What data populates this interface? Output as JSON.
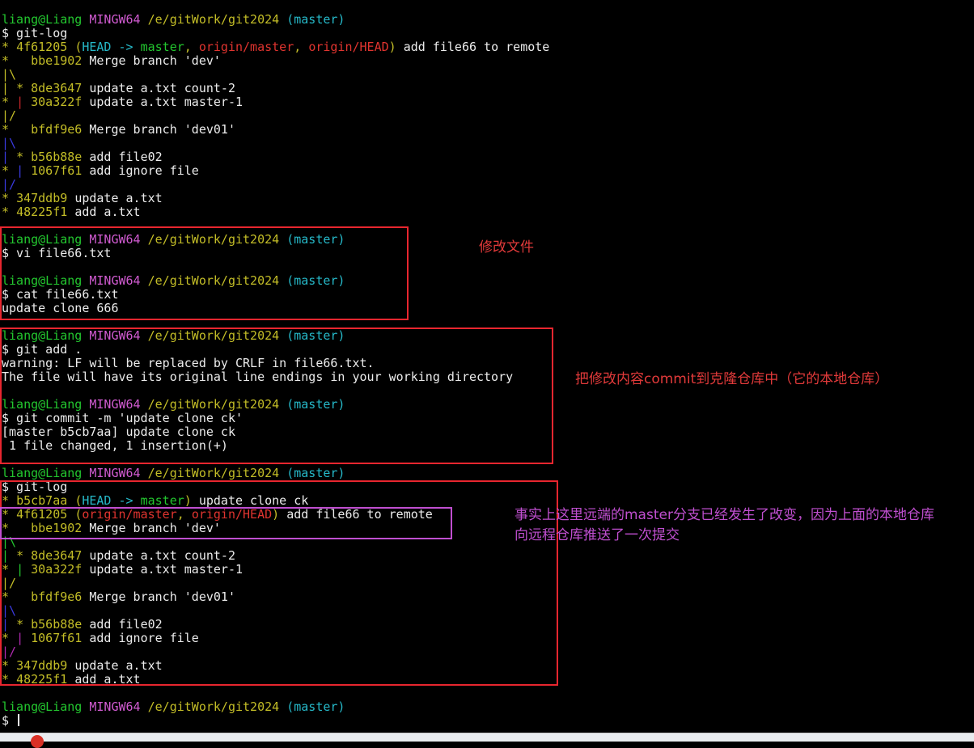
{
  "terminal": {
    "lines": [
      [
        {
          "t": "liang@Liang ",
          "c": "green"
        },
        {
          "t": "MINGW64 ",
          "c": "magenta"
        },
        {
          "t": "/e/gitWork/git2024 ",
          "c": "yellow"
        },
        {
          "t": "(master)",
          "c": "cyan"
        }
      ],
      [
        {
          "t": "$ git-log",
          "c": "white"
        }
      ],
      [
        {
          "t": "* ",
          "c": "gy"
        },
        {
          "t": "4f61205 ",
          "c": "yellow"
        },
        {
          "t": "(",
          "c": "yellow"
        },
        {
          "t": "HEAD -> ",
          "c": "cyan"
        },
        {
          "t": "master",
          "c": "green"
        },
        {
          "t": ", ",
          "c": "yellow"
        },
        {
          "t": "origin/master",
          "c": "red"
        },
        {
          "t": ", ",
          "c": "yellow"
        },
        {
          "t": "origin/HEAD",
          "c": "red"
        },
        {
          "t": ")",
          "c": "yellow"
        },
        {
          "t": " add file66 to remote",
          "c": "white"
        }
      ],
      [
        {
          "t": "*   ",
          "c": "gy"
        },
        {
          "t": "bbe1902 ",
          "c": "yellow"
        },
        {
          "t": "Merge branch 'dev'",
          "c": "white"
        }
      ],
      [
        {
          "t": "|\\",
          "c": "gy"
        }
      ],
      [
        {
          "t": "| ",
          "c": "gy"
        },
        {
          "t": "* ",
          "c": "gy"
        },
        {
          "t": "8de3647 ",
          "c": "yellow"
        },
        {
          "t": "update a.txt count-2",
          "c": "white"
        }
      ],
      [
        {
          "t": "* ",
          "c": "gy"
        },
        {
          "t": "| ",
          "c": "gr"
        },
        {
          "t": "30a322f ",
          "c": "yellow"
        },
        {
          "t": "update a.txt master-1",
          "c": "white"
        }
      ],
      [
        {
          "t": "|/",
          "c": "gy"
        }
      ],
      [
        {
          "t": "*   ",
          "c": "gy"
        },
        {
          "t": "bfdf9e6 ",
          "c": "yellow"
        },
        {
          "t": "Merge branch 'dev01'",
          "c": "white"
        }
      ],
      [
        {
          "t": "|\\",
          "c": "gb"
        }
      ],
      [
        {
          "t": "| ",
          "c": "gb"
        },
        {
          "t": "* ",
          "c": "gy"
        },
        {
          "t": "b56b88e ",
          "c": "yellow"
        },
        {
          "t": "add file02",
          "c": "white"
        }
      ],
      [
        {
          "t": "* ",
          "c": "gy"
        },
        {
          "t": "| ",
          "c": "gb"
        },
        {
          "t": "1067f61 ",
          "c": "yellow"
        },
        {
          "t": "add ignore file",
          "c": "white"
        }
      ],
      [
        {
          "t": "|/",
          "c": "gb"
        }
      ],
      [
        {
          "t": "* ",
          "c": "gy"
        },
        {
          "t": "347ddb9 ",
          "c": "yellow"
        },
        {
          "t": "update a.txt",
          "c": "white"
        }
      ],
      [
        {
          "t": "* ",
          "c": "gy"
        },
        {
          "t": "48225f1 ",
          "c": "yellow"
        },
        {
          "t": "add a.txt",
          "c": "white"
        }
      ],
      [
        {
          "t": "",
          "c": "white"
        }
      ],
      [
        {
          "t": "liang@Liang ",
          "c": "green"
        },
        {
          "t": "MINGW64 ",
          "c": "magenta"
        },
        {
          "t": "/e/gitWork/git2024 ",
          "c": "yellow"
        },
        {
          "t": "(master)",
          "c": "cyan"
        }
      ],
      [
        {
          "t": "$ vi file66.txt",
          "c": "white"
        }
      ],
      [
        {
          "t": "",
          "c": "white"
        }
      ],
      [
        {
          "t": "liang@Liang ",
          "c": "green"
        },
        {
          "t": "MINGW64 ",
          "c": "magenta"
        },
        {
          "t": "/e/gitWork/git2024 ",
          "c": "yellow"
        },
        {
          "t": "(master)",
          "c": "cyan"
        }
      ],
      [
        {
          "t": "$ cat file66.txt",
          "c": "white"
        }
      ],
      [
        {
          "t": "update clone 666",
          "c": "white"
        }
      ],
      [
        {
          "t": "",
          "c": "white"
        }
      ],
      [
        {
          "t": "liang@Liang ",
          "c": "green"
        },
        {
          "t": "MINGW64 ",
          "c": "magenta"
        },
        {
          "t": "/e/gitWork/git2024 ",
          "c": "yellow"
        },
        {
          "t": "(master)",
          "c": "cyan"
        }
      ],
      [
        {
          "t": "$ git add .",
          "c": "white"
        }
      ],
      [
        {
          "t": "warning: LF will be replaced by CRLF in file66.txt.",
          "c": "white"
        }
      ],
      [
        {
          "t": "The file will have its original line endings in your working directory",
          "c": "white"
        }
      ],
      [
        {
          "t": "",
          "c": "white"
        }
      ],
      [
        {
          "t": "liang@Liang ",
          "c": "green"
        },
        {
          "t": "MINGW64 ",
          "c": "magenta"
        },
        {
          "t": "/e/gitWork/git2024 ",
          "c": "yellow"
        },
        {
          "t": "(master)",
          "c": "cyan"
        }
      ],
      [
        {
          "t": "$ git commit -m 'update clone ck'",
          "c": "white"
        }
      ],
      [
        {
          "t": "[master b5cb7aa] update clone ck",
          "c": "white"
        }
      ],
      [
        {
          "t": " 1 file changed, 1 insertion(+)",
          "c": "white"
        }
      ],
      [
        {
          "t": "",
          "c": "white"
        }
      ],
      [
        {
          "t": "liang@Liang ",
          "c": "green"
        },
        {
          "t": "MINGW64 ",
          "c": "magenta"
        },
        {
          "t": "/e/gitWork/git2024 ",
          "c": "yellow"
        },
        {
          "t": "(master)",
          "c": "cyan"
        }
      ],
      [
        {
          "t": "$ git-log",
          "c": "white"
        }
      ],
      [
        {
          "t": "* ",
          "c": "gy"
        },
        {
          "t": "b5cb7aa ",
          "c": "yellow"
        },
        {
          "t": "(",
          "c": "yellow"
        },
        {
          "t": "HEAD -> ",
          "c": "cyan"
        },
        {
          "t": "master",
          "c": "green"
        },
        {
          "t": ")",
          "c": "yellow"
        },
        {
          "t": " update clone ck",
          "c": "white"
        }
      ],
      [
        {
          "t": "* ",
          "c": "gy"
        },
        {
          "t": "4f61205 ",
          "c": "yellow"
        },
        {
          "t": "(",
          "c": "yellow"
        },
        {
          "t": "origin/master",
          "c": "red"
        },
        {
          "t": ", ",
          "c": "yellow"
        },
        {
          "t": "origin/HEAD",
          "c": "red"
        },
        {
          "t": ")",
          "c": "yellow"
        },
        {
          "t": " add file66 to remote",
          "c": "white"
        }
      ],
      [
        {
          "t": "*   ",
          "c": "gy"
        },
        {
          "t": "bbe1902 ",
          "c": "yellow"
        },
        {
          "t": "Merge branch 'dev'",
          "c": "white"
        }
      ],
      [
        {
          "t": "|\\",
          "c": "gg"
        }
      ],
      [
        {
          "t": "| ",
          "c": "gg"
        },
        {
          "t": "* ",
          "c": "gy"
        },
        {
          "t": "8de3647 ",
          "c": "yellow"
        },
        {
          "t": "update a.txt count-2",
          "c": "white"
        }
      ],
      [
        {
          "t": "* ",
          "c": "gy"
        },
        {
          "t": "| ",
          "c": "gg"
        },
        {
          "t": "30a322f ",
          "c": "yellow"
        },
        {
          "t": "update a.txt master-1",
          "c": "white"
        }
      ],
      [
        {
          "t": "|/",
          "c": "gy"
        }
      ],
      [
        {
          "t": "*   ",
          "c": "gy"
        },
        {
          "t": "bfdf9e6 ",
          "c": "yellow"
        },
        {
          "t": "Merge branch 'dev01'",
          "c": "white"
        }
      ],
      [
        {
          "t": "|\\",
          "c": "gb"
        }
      ],
      [
        {
          "t": "| ",
          "c": "gb"
        },
        {
          "t": "* ",
          "c": "gy"
        },
        {
          "t": "b56b88e ",
          "c": "yellow"
        },
        {
          "t": "add file02",
          "c": "white"
        }
      ],
      [
        {
          "t": "* ",
          "c": "gy"
        },
        {
          "t": "| ",
          "c": "gp"
        },
        {
          "t": "1067f61 ",
          "c": "yellow"
        },
        {
          "t": "add ignore file",
          "c": "white"
        }
      ],
      [
        {
          "t": "|/",
          "c": "gp"
        }
      ],
      [
        {
          "t": "* ",
          "c": "gy"
        },
        {
          "t": "347ddb9 ",
          "c": "yellow"
        },
        {
          "t": "update a.txt",
          "c": "white"
        }
      ],
      [
        {
          "t": "* ",
          "c": "gy"
        },
        {
          "t": "48225f1 ",
          "c": "yellow"
        },
        {
          "t": "add a.txt",
          "c": "white"
        }
      ],
      [
        {
          "t": "",
          "c": "white"
        }
      ],
      [
        {
          "t": "liang@Liang ",
          "c": "green"
        },
        {
          "t": "MINGW64 ",
          "c": "magenta"
        },
        {
          "t": "/e/gitWork/git2024 ",
          "c": "yellow"
        },
        {
          "t": "(master)",
          "c": "cyan"
        }
      ],
      [
        {
          "t": "$ ",
          "c": "white"
        }
      ]
    ]
  },
  "annotations": {
    "note1": "修改文件",
    "note2": "把修改内容commit到克隆仓库中（它的本地仓库）",
    "note3_line1": "事实上这里远端的master分支已经发生了改变，因为上面的本地仓库",
    "note3_line2": "向远程仓库推送了一次提交"
  },
  "colors": {
    "background": "#000000",
    "prompt_user": "#23c72f",
    "prompt_system": "#d15bd1",
    "prompt_path": "#c3bd27",
    "prompt_branch": "#26b9c9",
    "ref_remote": "#e0342f",
    "annotation_box": "#e8262f",
    "annotation_box_highlight": "#c04fd0"
  }
}
